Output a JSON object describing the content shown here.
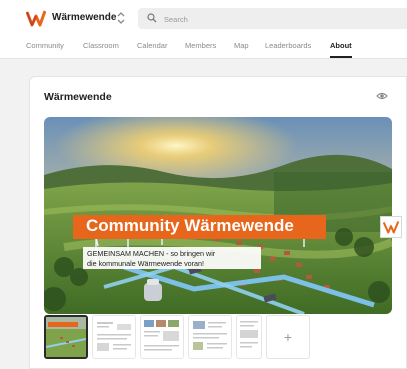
{
  "header": {
    "community_name": "Wärmewende",
    "logo_icon": "w-logo-icon",
    "switcher_icon": "chevron-up-down-icon",
    "search": {
      "placeholder": "Search",
      "icon": "search-icon"
    }
  },
  "nav": {
    "tabs": [
      {
        "label": "Community",
        "active": false
      },
      {
        "label": "Classroom",
        "active": false
      },
      {
        "label": "Calendar",
        "active": false
      },
      {
        "label": "Members",
        "active": false
      },
      {
        "label": "Map",
        "active": false
      },
      {
        "label": "Leaderboards",
        "active": false
      },
      {
        "label": "About",
        "active": true
      }
    ]
  },
  "about": {
    "title": "Wärmewende",
    "visibility_icon": "eye-icon",
    "hero": {
      "headline": "Community Wärmewende",
      "subtitle_line1": "GEMEINSAM MACHEN - so bringen wir",
      "subtitle_line2": "die kommunale Wärmewende voran!",
      "badge_icon": "w-logo-icon"
    },
    "gallery": {
      "thumbnail_count": 5,
      "selected_index": 0,
      "add_label": "+"
    }
  },
  "colors": {
    "brand_orange": "#e8651c",
    "logo_red": "#c0392b",
    "active_tab": "#202124",
    "inactive_tab": "#8a8a8a"
  }
}
